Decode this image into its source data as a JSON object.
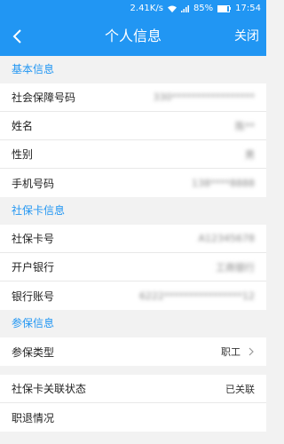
{
  "status_bar": {
    "speed": "2.41K/s",
    "battery": "85%",
    "battery_level": 0.85,
    "time": "17:54",
    "icons": [
      "wifi-icon",
      "signal-icon",
      "battery-icon"
    ]
  },
  "nav": {
    "back_icon": "back-arrow-icon",
    "title": "个人信息",
    "close": "关闭"
  },
  "sections": {
    "basic": {
      "title": "基本信息",
      "rows": [
        {
          "label": "社会保障号码",
          "value": "330*****************"
        },
        {
          "label": "姓名",
          "value": "陈**"
        },
        {
          "label": "性别",
          "value": "男"
        },
        {
          "label": "手机号码",
          "value": "138****8888"
        }
      ]
    },
    "card": {
      "title": "社保卡信息",
      "rows": [
        {
          "label": "社保卡号",
          "value": "A12345678"
        },
        {
          "label": "开户银行",
          "value": "工商银行"
        },
        {
          "label": "银行账号",
          "value": "6222****************12"
        }
      ]
    },
    "insurance": {
      "title": "参保信息",
      "rows": [
        {
          "label": "参保类型",
          "value": "职工"
        }
      ]
    },
    "other": {
      "rows": [
        {
          "label": "社保卡关联状态",
          "value": "已关联"
        },
        {
          "label": "职退情况",
          "value": ""
        }
      ]
    }
  },
  "colors": {
    "accent": "#2196f3",
    "background": "#f2f2f2"
  }
}
